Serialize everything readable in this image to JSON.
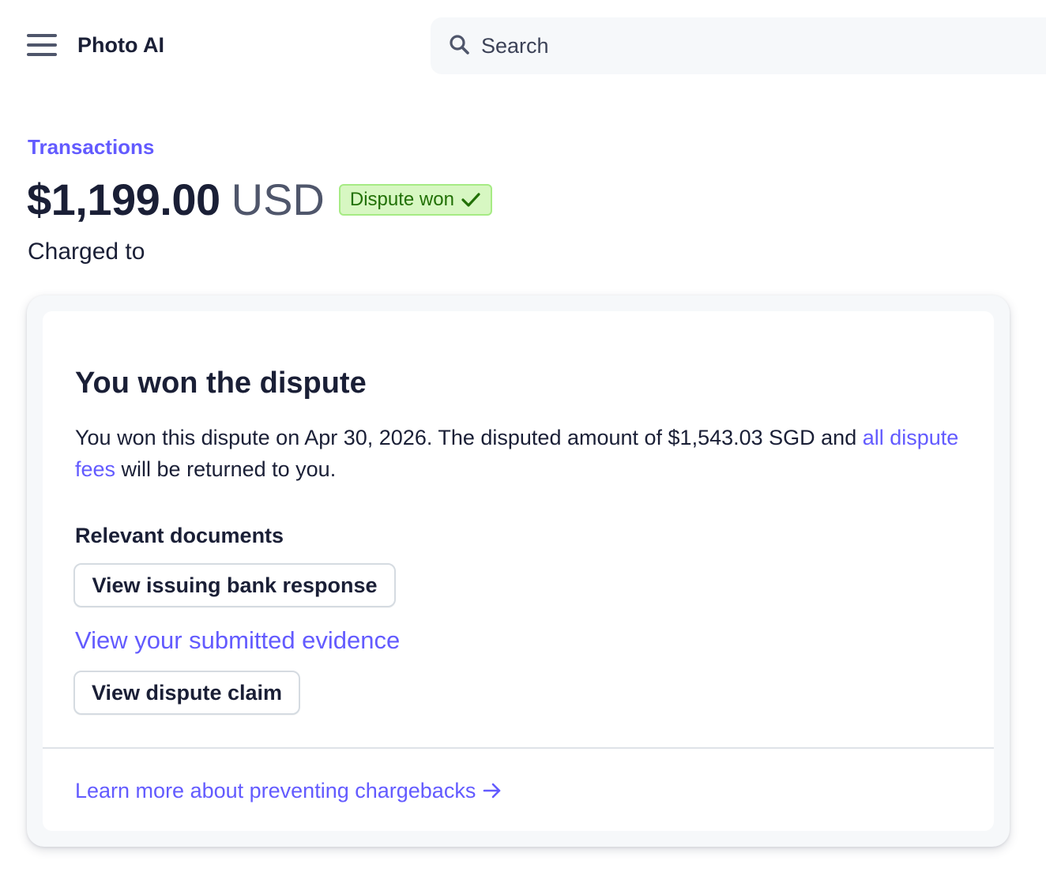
{
  "header": {
    "app_title": "Photo AI",
    "search_placeholder": "Search"
  },
  "breadcrumb": "Transactions",
  "payment": {
    "amount": "$1,199.00",
    "currency": "USD",
    "status_badge": "Dispute won",
    "charged_to_label": "Charged to"
  },
  "dispute_card": {
    "title": "You won the dispute",
    "text_before_link": "You won this dispute on Apr 30, 2026. The disputed amount of $1,543.03 SGD and ",
    "text_link": "all dispute fees",
    "text_after_link": " will be returned to you.",
    "documents_label": "Relevant documents",
    "bank_response_button": "View issuing bank response",
    "evidence_link": "View your submitted evidence",
    "dispute_claim_button": "View dispute claim",
    "learn_more_link": "Learn more about preventing chargebacks"
  },
  "colors": {
    "accent": "#635bff",
    "success_bg": "#d7f7c2",
    "success_border": "#a6eb84",
    "success_text": "#217005",
    "text_primary": "#1a1f36",
    "text_secondary": "#4f566b"
  },
  "icons": {
    "menu": "hamburger-menu-icon",
    "search": "search-icon",
    "badge": "checkmark-icon",
    "learn_more": "arrow-right-icon"
  }
}
